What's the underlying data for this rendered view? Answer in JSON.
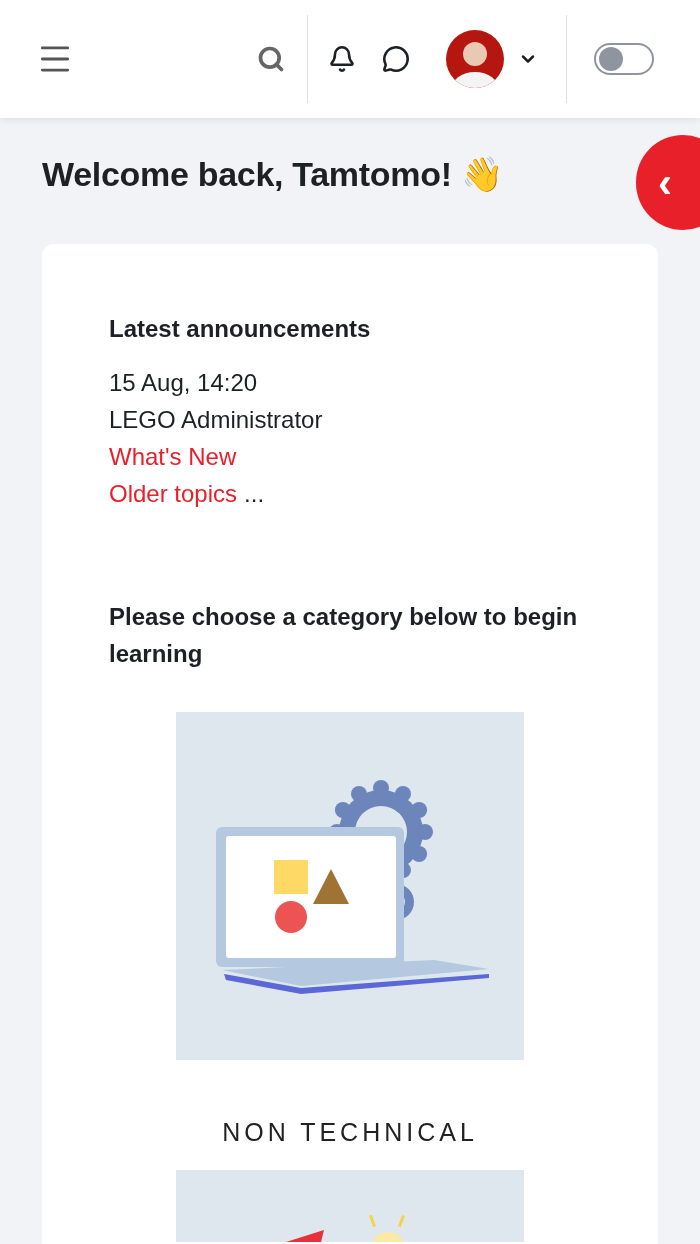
{
  "header": {
    "dark_mode_toggle": {
      "on": false
    }
  },
  "greeting": "Welcome back, Tamtomo! 👋",
  "drawer_toggle": {
    "glyph": "‹"
  },
  "announcements": {
    "title": "Latest announcements",
    "date": "15 Aug, 14:20",
    "author": "LEGO Administrator",
    "post_link": "What's New",
    "older_link": "Older topics",
    "older_suffix": "..."
  },
  "categories": {
    "prompt": "Please choose a category below to begin learning",
    "items": [
      {
        "kind": "laptop",
        "caption": "NON TECHNICAL"
      },
      {
        "kind": "idea"
      }
    ]
  }
}
